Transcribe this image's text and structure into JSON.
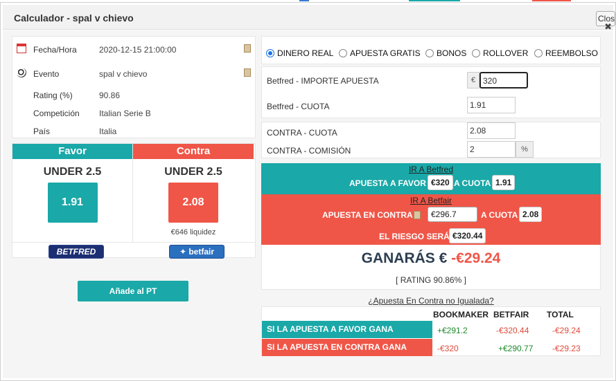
{
  "window": {
    "title": "Calculador - spal v chievo",
    "close_label": "Close",
    "close_x": "✖"
  },
  "info": {
    "fecha_label": "Fecha/Hora",
    "fecha_value": "2020-12-15 21:00:00",
    "evento_label": "Evento",
    "evento_value": "spal v chievo",
    "rating_label": "Rating (%)",
    "rating_value": "90.86",
    "competicion_label": "Competición",
    "competicion_value": "Italian Serie B",
    "pais_label": "País",
    "pais_value": "Italia"
  },
  "favor": {
    "header": "Favor",
    "selection": "UNDER 2.5",
    "odds": "1.91",
    "bookmaker_logo": "BETFRED"
  },
  "contra": {
    "header": "Contra",
    "selection": "UNDER 2.5",
    "odds": "2.08",
    "liquidity": "€646 liquidez",
    "exchange_logo": "betfair"
  },
  "add_button": "Añade al PT",
  "bet_types": [
    "DINERO REAL",
    "APUESTA GRATIS",
    "BONOS",
    "ROLLOVER",
    "REEMBOLSO"
  ],
  "selected_bet_type": "DINERO REAL",
  "calc": {
    "stake_label": "Betfred - IMPORTE APUESTA",
    "stake_currency": "€",
    "stake_value": "320",
    "back_odds_label": "Betfred - CUOTA",
    "back_odds_value": "1.91",
    "lay_odds_label": "CONTRA - CUOTA",
    "lay_odds_value": "2.08",
    "commission_label": "CONTRA - COMISIÓN",
    "commission_value": "2",
    "commission_unit": "%"
  },
  "result": {
    "go_bookmaker": "IR A Betfred",
    "favor_label": "APUESTA A FAVOR",
    "favor_amount": "€320",
    "favor_cuota_label": "A CUOTA",
    "favor_cuota": "1.91",
    "go_exchange": "IR A Betfair",
    "contra_label": "APUESTA EN CONTRA",
    "contra_amount": "€296.7",
    "contra_cuota_label": "A CUOTA",
    "contra_cuota": "2.08",
    "riesgo_label": "EL RIESGO SERÁ",
    "riesgo_amount": "€320.44",
    "ganaras_label": "GANARÁS €",
    "ganaras_value": "-€29.24",
    "rating_text": "[ RATING 90.86% ]"
  },
  "not_matched_link": "¿Apuesta En Contra no Igualada?",
  "table": {
    "headers": [
      "BOOKMAKER",
      "BETFAIR",
      "TOTAL"
    ],
    "rows": [
      {
        "label": "SI LA APUESTA A FAVOR GANA",
        "bookmaker": "+€291.2",
        "betfair": "-€320.44",
        "total": "-€29.24"
      },
      {
        "label": "SI LA APUESTA EN CONTRA GANA",
        "bookmaker": "-€320",
        "betfair": "+€290.77",
        "total": "-€29.23"
      }
    ]
  },
  "colors": {
    "favor": "#1aa8a8",
    "contra": "#ef5648",
    "positive": "#1e8a2a",
    "negative": "#e04a3a"
  }
}
